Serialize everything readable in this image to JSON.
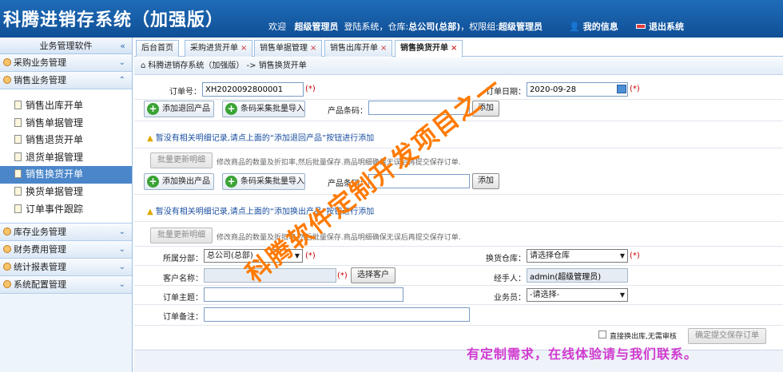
{
  "header": {
    "app_title": "科腾进销存系统（加强版）",
    "welcome_prefix": "欢迎",
    "user": "超级管理员",
    "login_text": "登陆系统，仓库:",
    "warehouse": "总公司(总部)",
    "perm_text": "，权限组:",
    "perm_group": "超级管理员",
    "my_info": "我的信息",
    "logout": "退出系统"
  },
  "sidebar": {
    "top_label": "业务管理软件",
    "groups": [
      {
        "label": "采购业务管理"
      },
      {
        "label": "销售业务管理"
      }
    ],
    "items": [
      {
        "label": "销售出库开单"
      },
      {
        "label": "销售单据管理"
      },
      {
        "label": "销售退货开单"
      },
      {
        "label": "退货单据管理"
      },
      {
        "label": "销售换货开单"
      },
      {
        "label": "换货单据管理"
      },
      {
        "label": "订单事件跟踪"
      }
    ],
    "groups_bottom": [
      {
        "label": "库存业务管理"
      },
      {
        "label": "财务费用管理"
      },
      {
        "label": "统计报表管理"
      },
      {
        "label": "系统配置管理"
      }
    ]
  },
  "tabs": [
    {
      "label": "后台首页"
    },
    {
      "label": "采购进货开单",
      "close": "×"
    },
    {
      "label": "销售单据管理",
      "close": "×"
    },
    {
      "label": "销售出库开单",
      "close": "×"
    },
    {
      "label": "销售换货开单",
      "close": "×"
    }
  ],
  "breadcrumb": "科腾进销存系统（加强版） -> 销售换货开单",
  "form": {
    "order_no_label": "订单号：",
    "order_no": "XH2020092800001",
    "req": "(*)",
    "order_date_label": "订单日期：",
    "order_date": "2020-09-28",
    "add_return_btn": "添加退回产品",
    "barcode_batch_btn": "条码采集批量导入",
    "barcode_label": "产品条码：",
    "add_btn": "添加",
    "warn_return": "暂没有相关明细记录,请点上面的“添加退回产品”按钮进行添加",
    "batch_update_btn": "批量更新明细",
    "batch_hint": "修改商品的数量及折扣率,然后批量保存.商品明细确保无误后再提交保存订单.",
    "add_exchange_btn": "添加换出产品",
    "warn_exchange": "暂没有相关明细记录,请点上面的“添加换出产品”按钮进行添加",
    "branch_label": "所属分部：",
    "branch_value": "总公司(总部)",
    "ex_warehouse_label": "换货仓库：",
    "ex_warehouse_value": "请选择仓库",
    "customer_label": "客户名称：",
    "select_customer_btn": "选择客户",
    "handler_label": "经手人：",
    "handler_value": "admin(超级管理员)",
    "subject_label": "订单主题：",
    "salesman_label": "业务员：",
    "salesman_value": "-请选择-",
    "remark_label": "订单备注：",
    "direct_out_label": "直接换出库,无需审核",
    "submit_btn": "确定提交保存订单"
  },
  "watermark": "科腾软件定制开发项目之一",
  "promo": "有定制需求，在线体验请与我们联系。"
}
